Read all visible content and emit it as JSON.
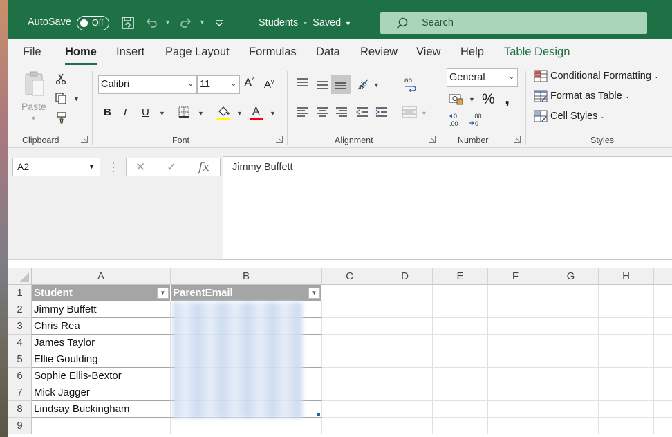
{
  "titlebar": {
    "autosave_label": "AutoSave",
    "autosave_state": "Off",
    "filename": "Students",
    "separator": "-",
    "save_status": "Saved",
    "search_placeholder": "Search"
  },
  "tabs": [
    "File",
    "Home",
    "Insert",
    "Page Layout",
    "Formulas",
    "Data",
    "Review",
    "View",
    "Help",
    "Table Design"
  ],
  "active_tab": "Home",
  "ribbon": {
    "clipboard": {
      "label": "Clipboard",
      "paste": "Paste"
    },
    "font": {
      "label": "Font",
      "name": "Calibri",
      "size": "11",
      "highlight_color": "#ffff00",
      "font_color": "#ff0000"
    },
    "alignment": {
      "label": "Alignment"
    },
    "number": {
      "label": "Number",
      "format": "General",
      "percent": "%",
      "comma": ",",
      "inc_decimal": ".00",
      "dec_decimal": ".00"
    },
    "styles": {
      "label": "Styles",
      "conditional": "Conditional Formatting",
      "format_table": "Format as Table",
      "cell_styles": "Cell Styles"
    }
  },
  "formula_bar": {
    "name_box": "A2",
    "fx": "fx",
    "content": "Jimmy Buffett"
  },
  "sheet": {
    "columns": [
      "A",
      "B",
      "C",
      "D",
      "E",
      "F",
      "G",
      "H"
    ],
    "rows": [
      "1",
      "2",
      "3",
      "4",
      "5",
      "6",
      "7",
      "8",
      "9"
    ],
    "table_headers": [
      "Student",
      "ParentEmail"
    ],
    "students": [
      "Jimmy Buffett",
      "Chris Rea",
      "James Taylor",
      "Ellie Goulding",
      "Sophie Ellis-Bextor",
      "Mick Jagger",
      "Lindsay Buckingham"
    ]
  },
  "colors": {
    "brand_green": "#1e7145",
    "table_header": "#a5a5a5"
  }
}
